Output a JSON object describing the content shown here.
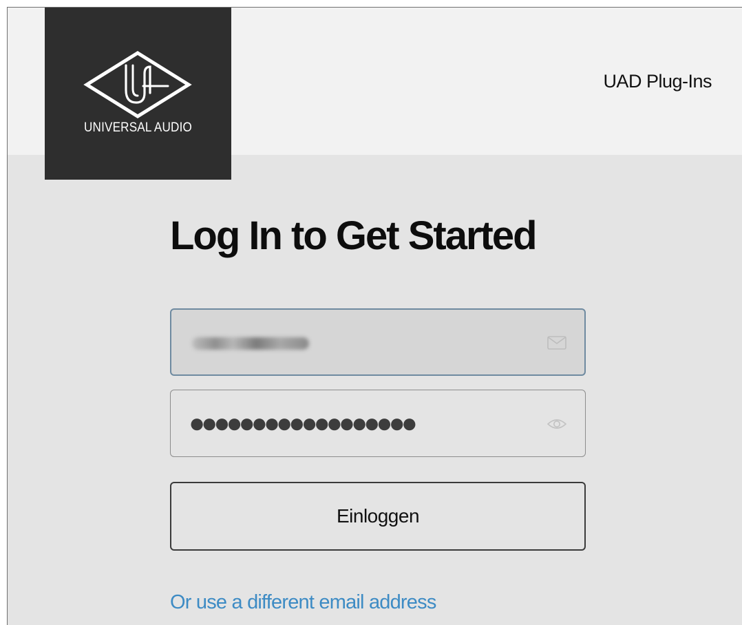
{
  "header": {
    "brand_name": "UNIVERSAL AUDIO",
    "nav_link": "UAD Plug-Ins"
  },
  "login": {
    "title": "Log In to Get Started",
    "email_value": "",
    "password_mask": "●●●●●●●●●●●●●●●●●●",
    "submit_label": "Einloggen",
    "alt_link": "Or use a different email address"
  },
  "icons": {
    "logo": "ua-diamond-logo",
    "email": "mail-icon",
    "password_toggle": "eye-icon"
  },
  "colors": {
    "logo_background": "#2e2e2e",
    "page_background": "#e4e4e4",
    "header_background": "#f2f2f2",
    "link": "#3d8bc4",
    "focus_border": "#6e8aa0"
  }
}
